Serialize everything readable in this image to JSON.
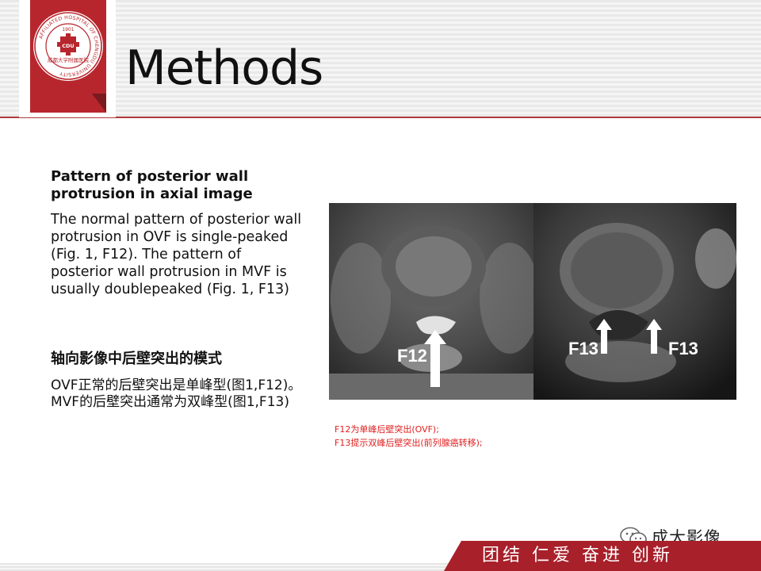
{
  "header": {
    "title": "Methods",
    "logo": {
      "ring_text": "AFFILIATED HOSPITAL OF CHENGDU UNIVERSITY",
      "year": "1901",
      "badge": "CDU",
      "cn_name": "成都大学附属医院"
    }
  },
  "body": {
    "en_heading": "Pattern of posterior wall protrusion in axial image",
    "en_paragraph": "The normal pattern of posterior wall protrusion in OVF is single-peaked (Fig. 1, F12). The pattern of posterior wall protrusion in MVF is usually doublepeaked (Fig. 1, F13)",
    "cn_heading": "轴向影像中后壁突出的模式",
    "cn_paragraph": "OVF正常的后壁突出是单峰型(图1,F12)。MVF的后壁突出通常为双峰型(图1,F13)"
  },
  "figure": {
    "left_label": "F12",
    "right_label_a": "F13",
    "right_label_b": "F13",
    "caption_line1": "F12为单峰后壁突出(OVF);",
    "caption_line2": "F13提示双峰后壁突出(前列腺癌转移);"
  },
  "footer": {
    "wechat_name": "成大影像",
    "motto": "团结  仁爱  奋进  创新"
  },
  "colors": {
    "brand_red": "#b8262d",
    "caption_red": "#e02020",
    "footer_red": "#a8202a"
  }
}
